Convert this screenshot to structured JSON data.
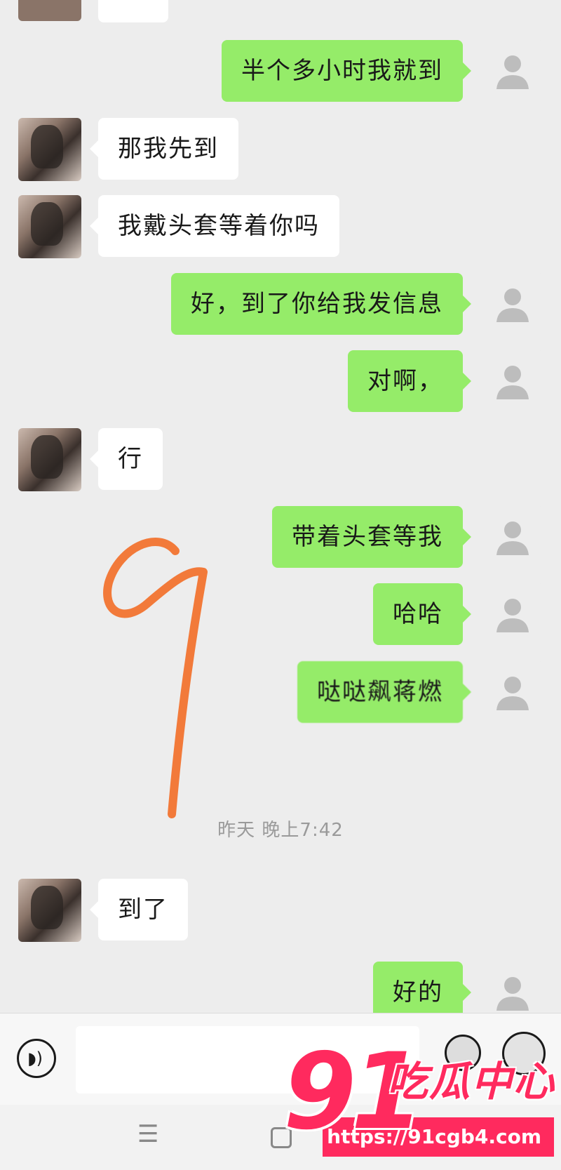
{
  "chat": {
    "messages": [
      {
        "side": "right",
        "text": "半个多小时我就到"
      },
      {
        "side": "left",
        "text": "那我先到"
      },
      {
        "side": "left",
        "text": "我戴头套等着你吗"
      },
      {
        "side": "right",
        "text": "好，到了你给我发信息"
      },
      {
        "side": "right",
        "text": "对啊，"
      },
      {
        "side": "left",
        "text": "行"
      },
      {
        "side": "right",
        "text": "带着头套等我"
      },
      {
        "side": "right",
        "text": "哈哈"
      },
      {
        "side": "right",
        "text": "哒哒飙蒋燃"
      },
      {
        "side": "left",
        "text": "到了"
      },
      {
        "side": "right",
        "text": "好的"
      }
    ],
    "timestamp": "昨天 晚上7:42",
    "annotation_color": "#f27a3a"
  },
  "input_bar": {
    "voice_icon": "voice-icon",
    "emoji_icon": "emoji-icon",
    "plus_icon": "plus-icon"
  },
  "navbar": {
    "menu_glyph": "☰",
    "home_icon": "home-icon"
  },
  "watermark": {
    "logo_number": "91",
    "logo_name": "吃瓜中心",
    "url": "https://91cgb4.com",
    "color": "#ff2a5e"
  }
}
